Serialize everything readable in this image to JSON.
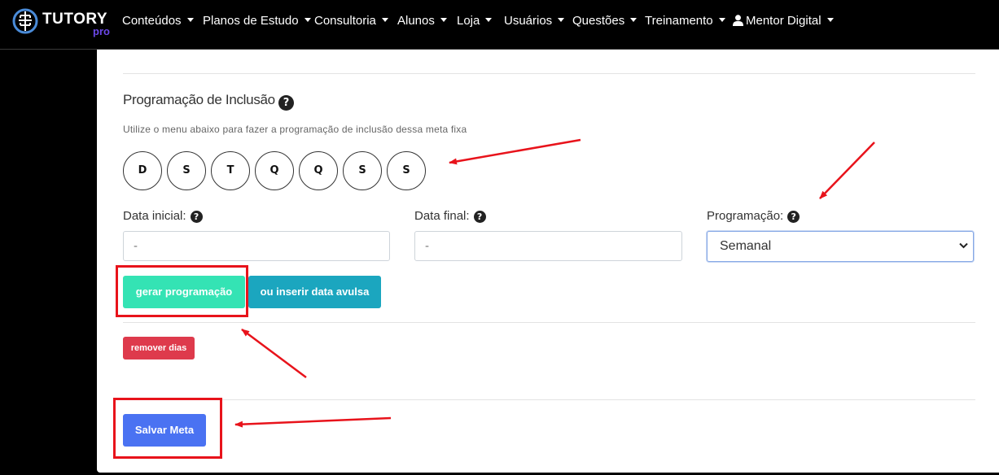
{
  "navbar": {
    "brand": {
      "name": "TUTORY",
      "sub": "pro"
    },
    "items": [
      {
        "label": "Conteúdos"
      },
      {
        "label": "Planos de Estudo"
      },
      {
        "label": "Consultoria"
      },
      {
        "label": "Alunos"
      },
      {
        "label": "Loja"
      },
      {
        "label": "Usuários"
      },
      {
        "label": "Questões"
      },
      {
        "label": "Treinamento"
      },
      {
        "label": "Mentor Digital",
        "icon": "user-icon"
      }
    ]
  },
  "form": {
    "section_title": "Programação de Inclusão",
    "help_icon": "question-circle-icon",
    "hint": "Utilize o menu abaixo para fazer a programação de inclusão dessa meta fixa",
    "days": [
      "D",
      "S",
      "T",
      "Q",
      "Q",
      "S",
      "S"
    ],
    "start_date": {
      "label": "Data inicial:",
      "value": "-"
    },
    "end_date": {
      "label": "Data final:",
      "value": "-"
    },
    "schedule": {
      "label": "Programação:",
      "value": "Semanal"
    },
    "generate_label": "gerar programação",
    "single_date_label": "ou inserir data avulsa",
    "remove_days_label": "remover dias",
    "save_label": "Salvar Meta"
  },
  "colors": {
    "navbar_bg": "#000000",
    "brand_accent": "#6b48e8",
    "generate_button": "#34e3b4",
    "single_date_button": "#1ba6bf",
    "remove_button": "#de3a4c",
    "save_button": "#4a72f2",
    "annotation": "#e8131b"
  }
}
